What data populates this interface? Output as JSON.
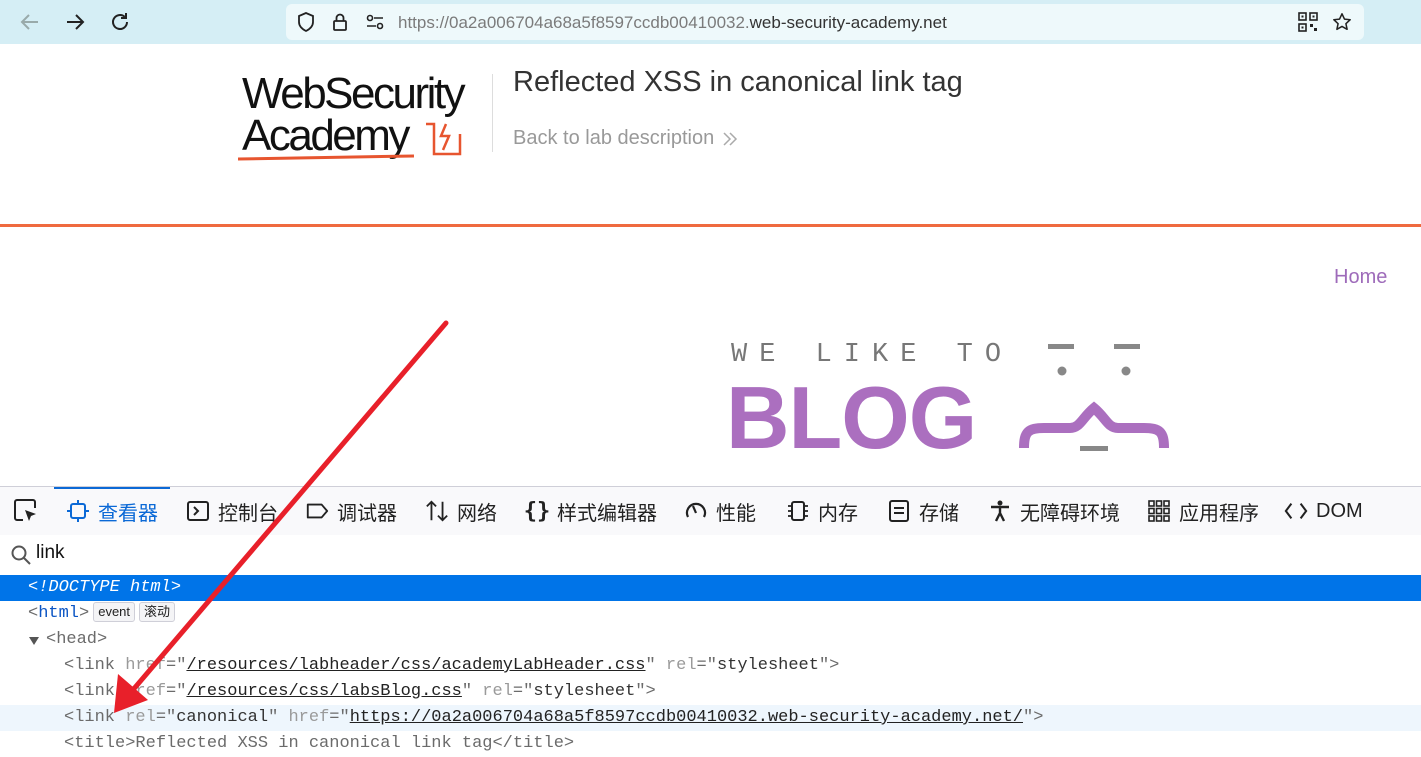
{
  "browser": {
    "url_dim": "https://0a2a006704a68a5f8597ccdb00410032.",
    "url_domain": "web-security-academy.net",
    "icons": [
      "back-icon",
      "forward-icon",
      "reload-icon",
      "shield-icon",
      "lock-icon",
      "permissions-icon",
      "qr-code-icon",
      "bookmark-star-icon"
    ]
  },
  "lab_header": {
    "logo_line1": "WebSecurity",
    "logo_line2": "Academy",
    "title": "Reflected XSS in canonical link tag",
    "back_link": "Back to lab description"
  },
  "blog": {
    "home_link": "Home",
    "banner_small": "WE LIKE TO",
    "banner_big": "BLOG"
  },
  "devtools": {
    "tabs": [
      {
        "label": "查看器",
        "icon": "inspector-icon",
        "active": true
      },
      {
        "label": "控制台",
        "icon": "console-icon",
        "active": false
      },
      {
        "label": "调试器",
        "icon": "debugger-icon",
        "active": false
      },
      {
        "label": "网络",
        "icon": "network-icon",
        "active": false
      },
      {
        "label": "样式编辑器",
        "icon": "style-editor-icon",
        "active": false
      },
      {
        "label": "性能",
        "icon": "performance-icon",
        "active": false
      },
      {
        "label": "内存",
        "icon": "memory-icon",
        "active": false
      },
      {
        "label": "存储",
        "icon": "storage-icon",
        "active": false
      },
      {
        "label": "无障碍环境",
        "icon": "accessibility-icon",
        "active": false
      },
      {
        "label": "应用程序",
        "icon": "application-icon",
        "active": false
      },
      {
        "label": "DOM",
        "icon": "dom-icon",
        "active": false
      }
    ],
    "search_value": "link",
    "tree": {
      "doctype": "<!DOCTYPE html>",
      "html_tag": "html",
      "badge_event": "event",
      "badge_scroll": "滚动",
      "head_tag": "head",
      "link1_href": "/resources/labheader/css/academyLabHeader.css",
      "link1_rel": "stylesheet",
      "link2_href": "/resources/css/labsBlog.css",
      "link2_rel": "stylesheet",
      "link3_rel": "canonical",
      "link3_href": "https://0a2a006704a68a5f8597ccdb00410032.web-security-academy.net/",
      "title_text": "Reflected XSS in canonical link tag"
    }
  },
  "colors": {
    "accent_blue": "#0074e8",
    "academy_orange": "#ef6a3f",
    "blog_purple": "#ab6fbf",
    "annotation_red": "#e8202a"
  }
}
